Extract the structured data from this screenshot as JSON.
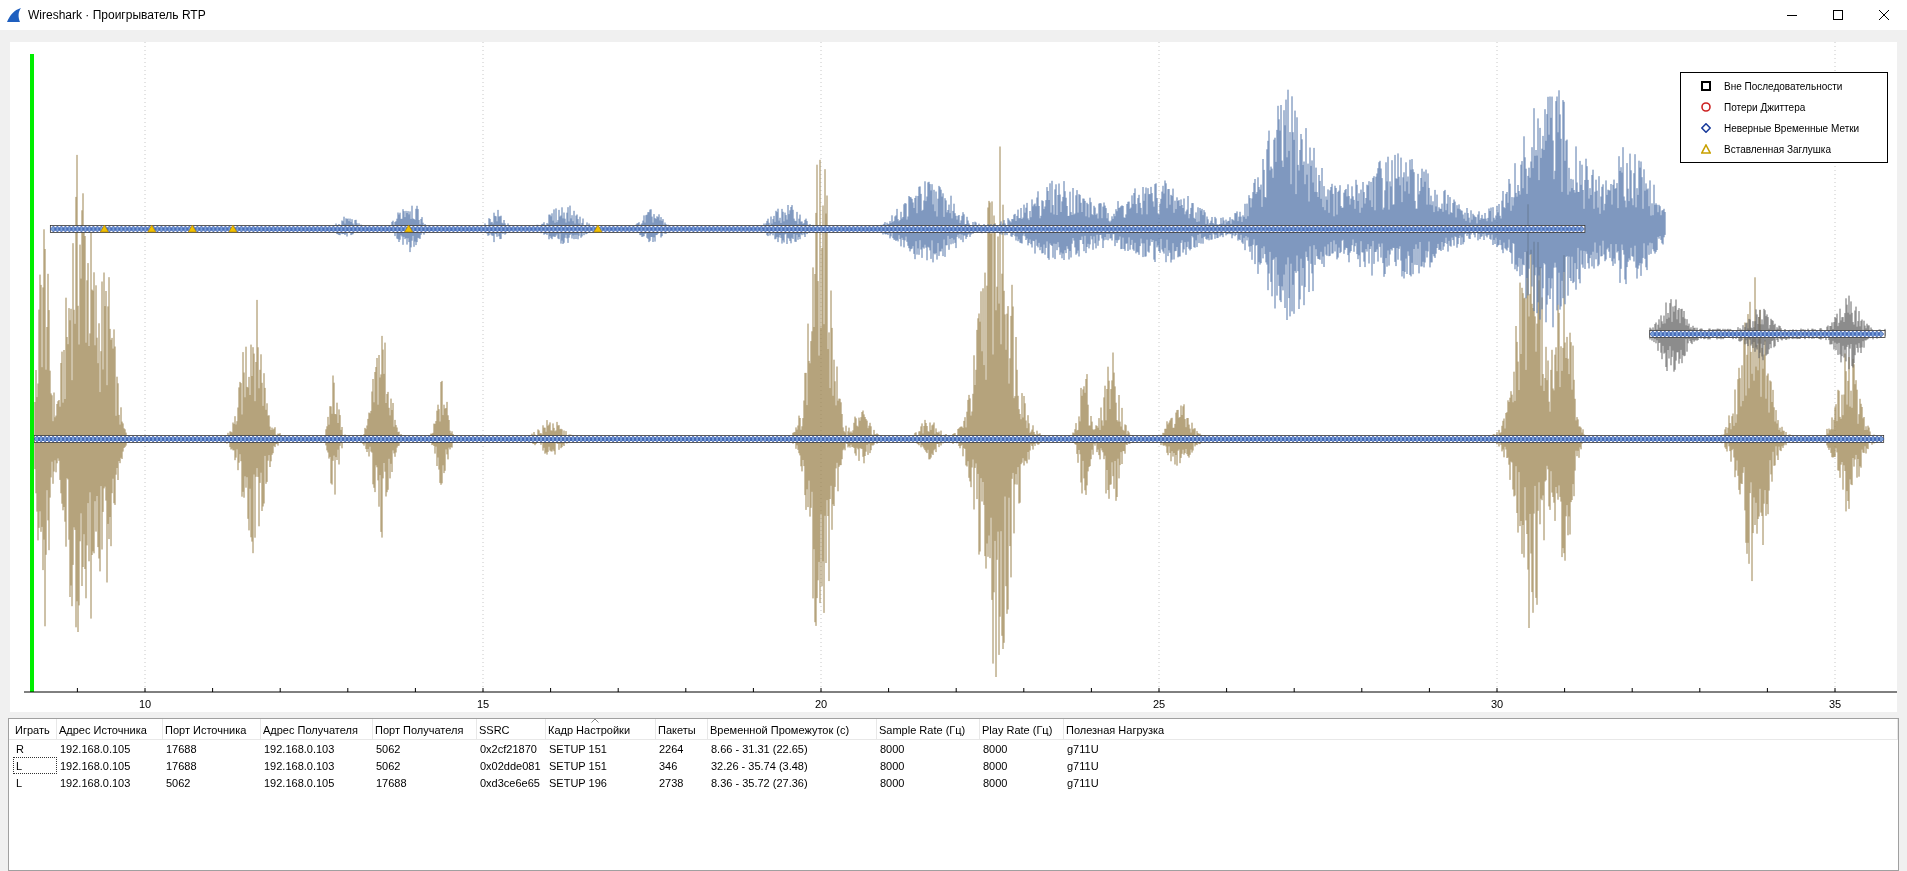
{
  "window": {
    "title": "Wireshark · Проигрыватель RTP"
  },
  "plot": {
    "xticks": [
      "10",
      "15",
      "20",
      "25",
      "30",
      "35"
    ],
    "legend": [
      {
        "kind": "square",
        "label": "Вне Последовательности",
        "color": "#000000"
      },
      {
        "kind": "circle",
        "label": "Потери Джиттера",
        "color": "#cc2222"
      },
      {
        "kind": "diamond",
        "label": "Неверные Временные Метки",
        "color": "#1a3c9c"
      },
      {
        "kind": "triangle",
        "label": "Вставленная Заглушка",
        "color": "#c8a000"
      }
    ]
  },
  "table": {
    "columns": [
      {
        "label": "Играть",
        "sorted": false
      },
      {
        "label": "Адрес Источника",
        "sorted": false
      },
      {
        "label": "Порт Источника",
        "sorted": false
      },
      {
        "label": "Адрес Получателя",
        "sorted": false
      },
      {
        "label": "Порт Получателя",
        "sorted": false
      },
      {
        "label": "SSRC",
        "sorted": false
      },
      {
        "label": "Кадр Настройки",
        "sorted": true
      },
      {
        "label": "Пакеты",
        "sorted": false
      },
      {
        "label": "Временной Промежуток (с)",
        "sorted": false
      },
      {
        "label": "Sample Rate (Гц)",
        "sorted": false
      },
      {
        "label": "Play Rate (Гц)",
        "sorted": false
      },
      {
        "label": "Полезная Нагрузка",
        "sorted": false
      }
    ],
    "rows": [
      {
        "focused": false,
        "cells": [
          "R",
          "192.168.0.105",
          "17688",
          "192.168.0.103",
          "5062",
          "0x2cf21870",
          "SETUP 151",
          "2264",
          "8.66 - 31.31 (22.65)",
          "8000",
          "8000",
          "g711U"
        ]
      },
      {
        "focused": true,
        "cells": [
          "L",
          "192.168.0.105",
          "17688",
          "192.168.0.103",
          "5062",
          "0x02dde081",
          "SETUP 151",
          "346",
          "32.26 - 35.74 (3.48)",
          "8000",
          "8000",
          "g711U"
        ]
      },
      {
        "focused": false,
        "cells": [
          "L",
          "192.168.0.103",
          "5062",
          "192.168.0.105",
          "17688",
          "0xd3ce6e65",
          "SETUP 196",
          "2738",
          "8.36 - 35.72 (27.36)",
          "8000",
          "8000",
          "g711U"
        ]
      }
    ]
  }
}
